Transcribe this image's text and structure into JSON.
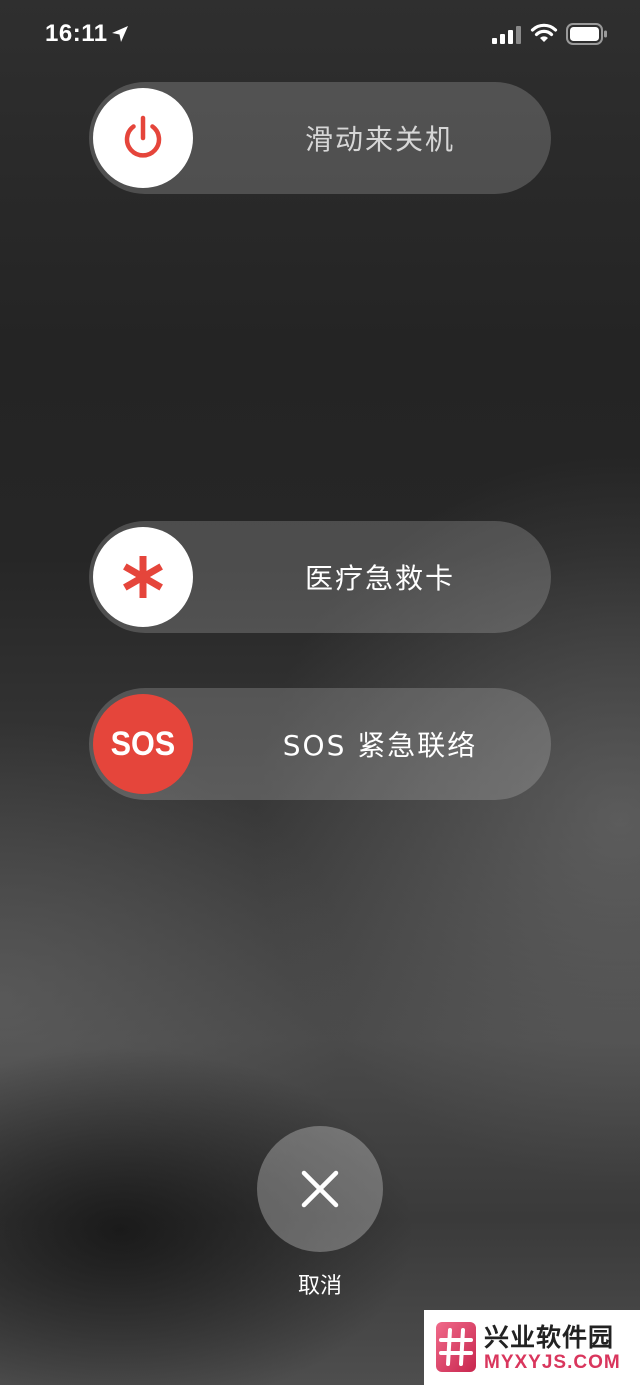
{
  "status_bar": {
    "time": "16:11",
    "icons": [
      "location-arrow-icon",
      "cellular-signal-icon",
      "wifi-icon",
      "battery-icon"
    ]
  },
  "sliders": {
    "power_off": {
      "label": "滑动来关机",
      "icon": "power-icon",
      "knob_color": "#ffffff",
      "icon_color": "#e5453b"
    },
    "medical_id": {
      "label": "医疗急救卡",
      "icon": "asterisk-icon",
      "knob_color": "#ffffff",
      "icon_color": "#e5453b"
    },
    "emergency_sos": {
      "label": "SOS 紧急联络",
      "knob_text": "SOS",
      "knob_color": "#e5453b"
    }
  },
  "cancel": {
    "label": "取消",
    "icon": "close-icon"
  },
  "watermark": {
    "title": "兴业软件园",
    "url": "MYXYJS.COM",
    "accent_color": "#d9365d"
  }
}
